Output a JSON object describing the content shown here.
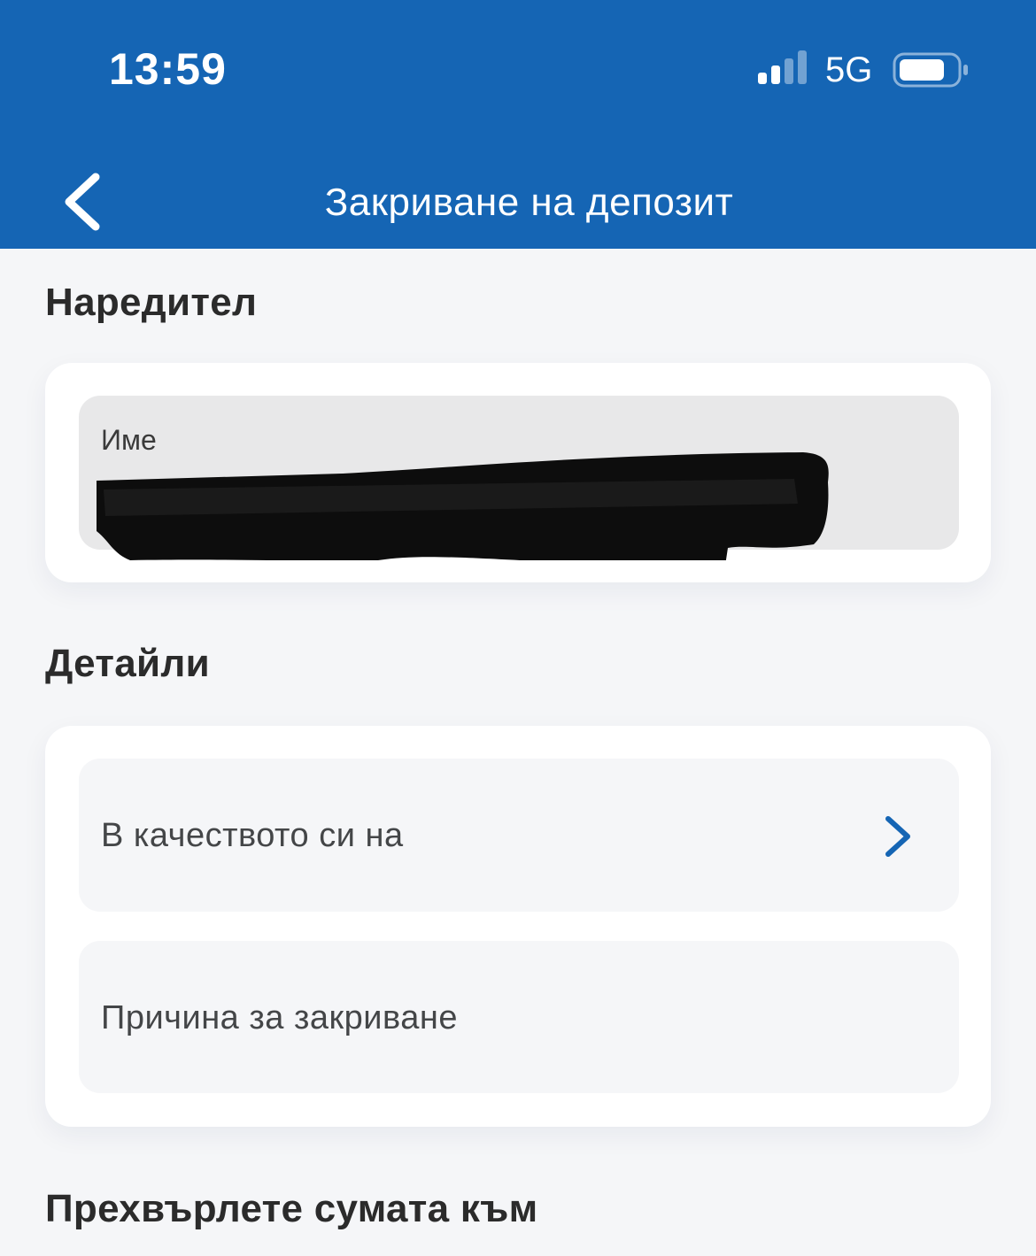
{
  "status_bar": {
    "time": "13:59",
    "network": "5G",
    "signal_bars_active": 2,
    "signal_bars_total": 4
  },
  "header": {
    "title": "Закриване на депозит",
    "back_icon": "chevron-left-icon"
  },
  "sections": {
    "orderer": {
      "title": "Наредител",
      "name_field": {
        "label": "Име",
        "value_redacted": true
      }
    },
    "details": {
      "title": "Детайли",
      "capacity_field": {
        "label": "В качеството си на",
        "icon": "chevron-right-icon"
      },
      "reason_field": {
        "label": "Причина за закриване"
      }
    },
    "transfer": {
      "title": "Прехвърлете сумата към"
    }
  },
  "colors": {
    "brand_blue": "#1565b4",
    "background": "#f5f6f8",
    "card": "#ffffff",
    "readonly_field": "#e8e8e9"
  }
}
